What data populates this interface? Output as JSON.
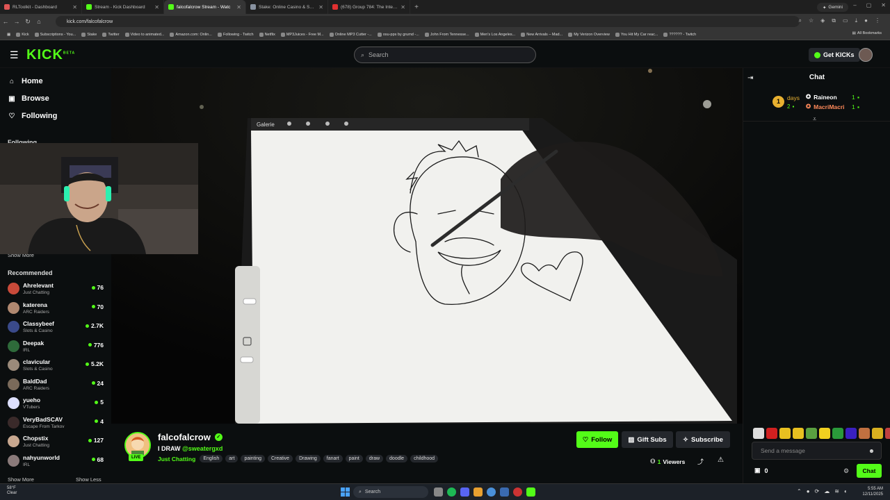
{
  "browser": {
    "tabs": [
      {
        "title": "RLToolkit - Dashboard",
        "color": "#e05555"
      },
      {
        "title": "Stream - Kick Dashboard",
        "color": "#53fc18"
      },
      {
        "title": "falcofalcrow Stream - Watc",
        "color": "#53fc18"
      },
      {
        "title": "Stake: Online Casino & Sports",
        "color": "#8892a0"
      },
      {
        "title": "(678) Group 784: The Internet",
        "color": "#e03030"
      }
    ],
    "gemini_label": "Gemini",
    "url": "kick.com/falcofalcrow",
    "bookmarks": [
      "Kick",
      "Subscriptions - You...",
      "Stake",
      "Twitter",
      "Video to animated...",
      "Amazon.com: Onlin...",
      "Following - Twitch",
      "Netflix",
      "MP3Juices - Free M...",
      "Online MP3 Cutter -...",
      "osu-pps by grumd -...",
      "John From Tennesse...",
      "Men's Los Angeles...",
      "New Arrivals – Mad...",
      "My Verizon Overview",
      "You Hit My Car reac...",
      "?????? - Twitch"
    ],
    "all_bookmarks": "All Bookmarks"
  },
  "header": {
    "logo": "KICK",
    "logo_badge": "BETA",
    "search_placeholder": "Search",
    "get_kicks": "Get KICKs"
  },
  "sidebar": {
    "nav": [
      {
        "label": "Home",
        "icon": "home-icon"
      },
      {
        "label": "Browse",
        "icon": "browse-icon"
      },
      {
        "label": "Following",
        "icon": "heart-icon"
      }
    ],
    "following_partial": "Following",
    "show_more_top": "Show More",
    "recommended_title": "Recommended",
    "recommended": [
      {
        "name": "Ahrelevant",
        "category": "Just Chatting",
        "viewers": "76",
        "color": "#c94a3a"
      },
      {
        "name": "katerena",
        "category": "ARC Raiders",
        "viewers": "70",
        "color": "#b08870"
      },
      {
        "name": "Classybeef",
        "category": "Slots & Casino",
        "viewers": "2.7K",
        "color": "#3a4a8a"
      },
      {
        "name": "Deepak",
        "category": "IRL",
        "viewers": "776",
        "color": "#2e6a3a"
      },
      {
        "name": "clavicular",
        "category": "Slots & Casino",
        "viewers": "5.2K",
        "color": "#9a8a7a"
      },
      {
        "name": "BaldDad",
        "category": "ARC Raiders",
        "viewers": "24",
        "color": "#7a6a5a"
      },
      {
        "name": "yueho",
        "category": "VTubers",
        "viewers": "5",
        "color": "#dde0ff"
      },
      {
        "name": "VeryBadSCAV",
        "category": "Escape From Tarkov",
        "viewers": "4",
        "color": "#3a2a2a"
      },
      {
        "name": "Chopstix",
        "category": "Just Chatting",
        "viewers": "127",
        "color": "#c8a890"
      },
      {
        "name": "nahyunworld",
        "category": "IRL",
        "viewers": "68",
        "color": "#8a7a7a"
      }
    ],
    "show_more": "Show More",
    "show_less": "Show Less"
  },
  "player": {
    "app_menu": "Galerie"
  },
  "chat": {
    "title": "Chat",
    "days_label": "days",
    "days_value": "2",
    "leaders": [
      {
        "name": "Raineon",
        "count": "1",
        "color": "#ffffff"
      },
      {
        "name": "MacriMacri",
        "count": "1",
        "color": "#ff8a5a"
      }
    ],
    "placeholder": "Send a message",
    "kick_count": "0",
    "chat_button": "Chat"
  },
  "stream": {
    "name": "falcofalcrow",
    "live": "LIVE",
    "title": "I DRAW",
    "mention": "@sweatergxd",
    "category": "Just Chatting",
    "tags": [
      "English",
      "art",
      "painting",
      "Creative",
      "Drawing",
      "fanart",
      "paint",
      "draw",
      "doodle",
      "childhood"
    ],
    "follow": "Follow",
    "gift_subs": "Gift Subs",
    "subscribe": "Subscribe",
    "viewers_count": "1",
    "viewers_label": "Viewers"
  },
  "taskbar": {
    "temp": "58°F",
    "weather": "Clear",
    "search": "Search",
    "time": "5:55 AM",
    "date": "12/11/2025"
  }
}
